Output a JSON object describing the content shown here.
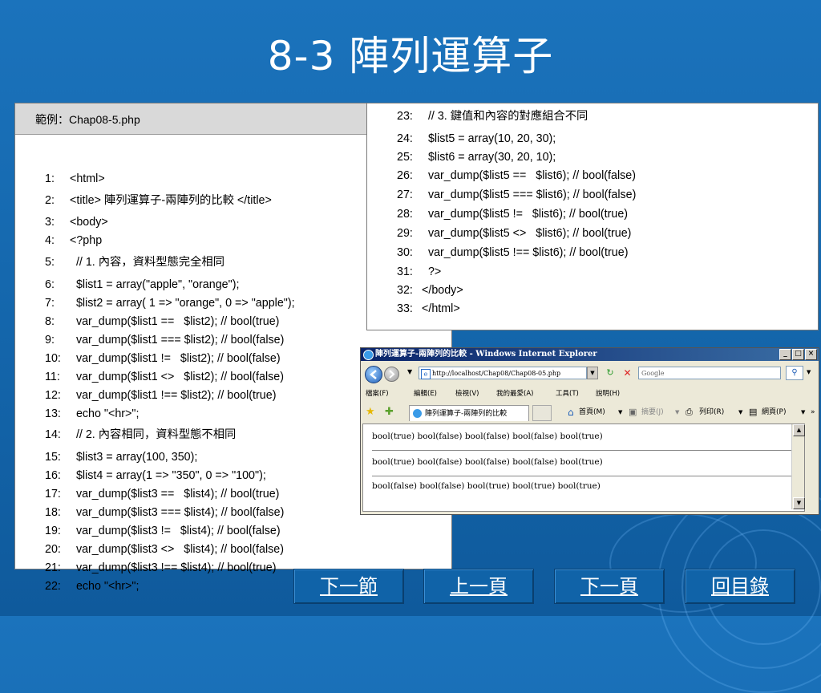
{
  "slide": {
    "title": "8-3  陣列運算子"
  },
  "left_panel": {
    "header": "範例：Chap08-5.php",
    "lines": [
      {
        "n": "1:",
        "t": "<html>"
      },
      {
        "n": "2:",
        "t": "<title> 陣列運算子-兩陣列的比較 </title>"
      },
      {
        "n": "3:",
        "t": "<body>"
      },
      {
        "n": "4:",
        "t": "<?php"
      },
      {
        "n": "5:",
        "t": "  // 1. 內容，資料型態完全相同"
      },
      {
        "n": "6:",
        "t": "  $list1 = array(\"apple\", \"orange\");"
      },
      {
        "n": "7:",
        "t": "  $list2 = array( 1 => \"orange\", 0 => \"apple\");"
      },
      {
        "n": "8:",
        "t": "  var_dump($list1 ==   $list2); // bool(true)"
      },
      {
        "n": "9:",
        "t": "  var_dump($list1 === $list2); // bool(false)"
      },
      {
        "n": "10:",
        "t": "  var_dump($list1 !=   $list2); // bool(false)"
      },
      {
        "n": "11:",
        "t": "  var_dump($list1 <>   $list2); // bool(false)"
      },
      {
        "n": "12:",
        "t": "  var_dump($list1 !== $list2); // bool(true)"
      },
      {
        "n": "13:",
        "t": "  echo \"<hr>\";"
      },
      {
        "n": "14:",
        "t": "  // 2. 內容相同，資料型態不相同"
      },
      {
        "n": "15:",
        "t": "  $list3 = array(100, 350);"
      },
      {
        "n": "16:",
        "t": "  $list4 = array(1 => \"350\", 0 => \"100\");"
      },
      {
        "n": "17:",
        "t": "  var_dump($list3 ==   $list4); // bool(true)"
      },
      {
        "n": "18:",
        "t": "  var_dump($list3 === $list4); // bool(false)"
      },
      {
        "n": "19:",
        "t": "  var_dump($list3 !=   $list4); // bool(false)"
      },
      {
        "n": "20:",
        "t": "  var_dump($list3 <>   $list4); // bool(false)"
      },
      {
        "n": "21:",
        "t": "  var_dump($list3 !== $list4); // bool(true)"
      },
      {
        "n": "22:",
        "t": "  echo \"<hr>\";"
      }
    ]
  },
  "right_panel": {
    "lines": [
      {
        "n": "23:",
        "t": "  // 3. 鍵值和內容的對應組合不同"
      },
      {
        "n": "24:",
        "t": "  $list5 = array(10, 20, 30);"
      },
      {
        "n": "25:",
        "t": "  $list6 = array(30, 20, 10);"
      },
      {
        "n": "26:",
        "t": "  var_dump($list5 ==   $list6); // bool(false)"
      },
      {
        "n": "27:",
        "t": "  var_dump($list5 === $list6); // bool(false)"
      },
      {
        "n": "28:",
        "t": "  var_dump($list5 !=   $list6); // bool(true)"
      },
      {
        "n": "29:",
        "t": "  var_dump($list5 <>   $list6); // bool(true)"
      },
      {
        "n": "30:",
        "t": "  var_dump($list5 !== $list6); // bool(true)"
      },
      {
        "n": "31:",
        "t": "  ?>"
      },
      {
        "n": "32:",
        "t": "</body>"
      },
      {
        "n": "33:",
        "t": "</html>"
      }
    ]
  },
  "browser": {
    "window_title": "陣列運算子-兩陣列的比較 - Windows Internet Explorer",
    "address": "http://localhost/Chap08/Chap08-05.php",
    "search_placeholder": "Google",
    "menu": [
      "檔案(F)",
      "編輯(E)",
      "檢視(V)",
      "我的最愛(A)",
      "工具(T)",
      "說明(H)"
    ],
    "tab_label": "陣列運算子-兩陣列的比較",
    "toolbar": [
      "首頁(M)",
      "摘要(J)",
      "列印(R)",
      "網頁(P)"
    ],
    "results": [
      "bool(true) bool(false) bool(false) bool(false) bool(true)",
      "bool(true) bool(false) bool(false) bool(false) bool(true)",
      "bool(false) bool(false) bool(true) bool(true) bool(true)"
    ]
  },
  "nav": {
    "next_section": "下一節",
    "prev_page": "上一頁",
    "next_page": "下一頁",
    "toc": "回目錄"
  }
}
